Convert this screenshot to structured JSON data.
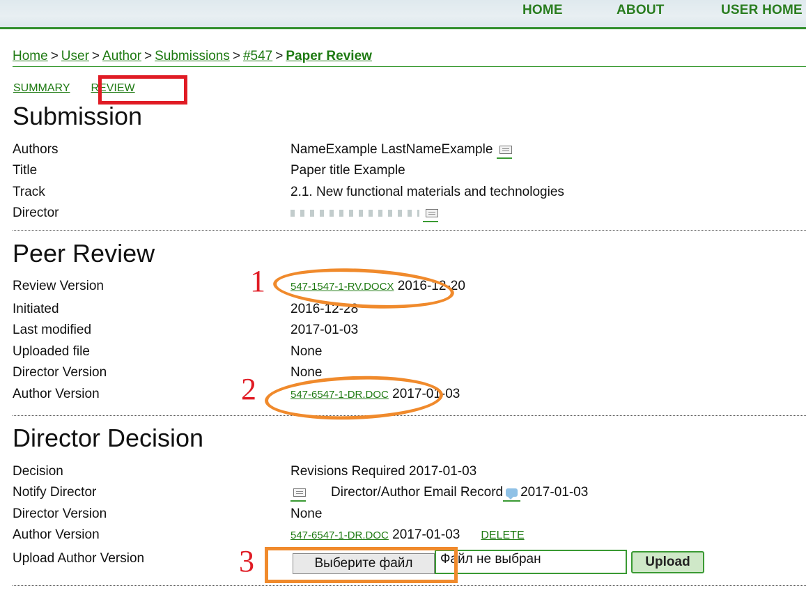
{
  "topnav": {
    "home": "HOME",
    "about": "ABOUT",
    "user_home": "USER HOME"
  },
  "breadcrumb": {
    "home": "Home",
    "user": "User",
    "author": "Author",
    "submissions": "Submissions",
    "id": "#547",
    "current": "Paper Review",
    "sep": ">"
  },
  "tabs": {
    "summary": "SUMMARY",
    "review": "REVIEW"
  },
  "submission": {
    "heading": "Submission",
    "authors_label": "Authors",
    "authors_value": "NameExample LastNameExample",
    "title_label": "Title",
    "title_value": "Paper title Example",
    "track_label": "Track",
    "track_value": "2.1. New functional materials and technologies",
    "director_label": "Director"
  },
  "peer_review": {
    "heading": "Peer Review",
    "review_version_label": "Review Version",
    "review_version_file": "547-1547-1-RV.DOCX",
    "review_version_date": "2016-12-20",
    "initiated_label": "Initiated",
    "initiated_value": "2016-12-28",
    "last_modified_label": "Last modified",
    "last_modified_value": "2017-01-03",
    "uploaded_file_label": "Uploaded file",
    "uploaded_file_value": "None",
    "director_version_label": "Director Version",
    "director_version_value": "None",
    "author_version_label": "Author Version",
    "author_version_file": "547-6547-1-DR.DOC",
    "author_version_date": "2017-01-03"
  },
  "director_decision": {
    "heading": "Director Decision",
    "decision_label": "Decision",
    "decision_value": "Revisions Required 2017-01-03",
    "notify_label": "Notify Director",
    "notify_record": "Director/Author Email Record",
    "notify_date": "2017-01-03",
    "director_version_label": "Director Version",
    "director_version_value": "None",
    "author_version_label": "Author Version",
    "author_version_file": "547-6547-1-DR.DOC",
    "author_version_date": "2017-01-03",
    "delete_label": "DELETE",
    "upload_label": "Upload Author Version",
    "choose_file": "Выберите файл",
    "no_file": "Файл не выбран",
    "upload_button": "Upload"
  },
  "annotations": {
    "one": "1",
    "two": "2",
    "three": "3"
  },
  "colors": {
    "link_green": "#1e7a12",
    "highlight_red": "#e01b24",
    "highlight_orange": "#f08a2c"
  }
}
